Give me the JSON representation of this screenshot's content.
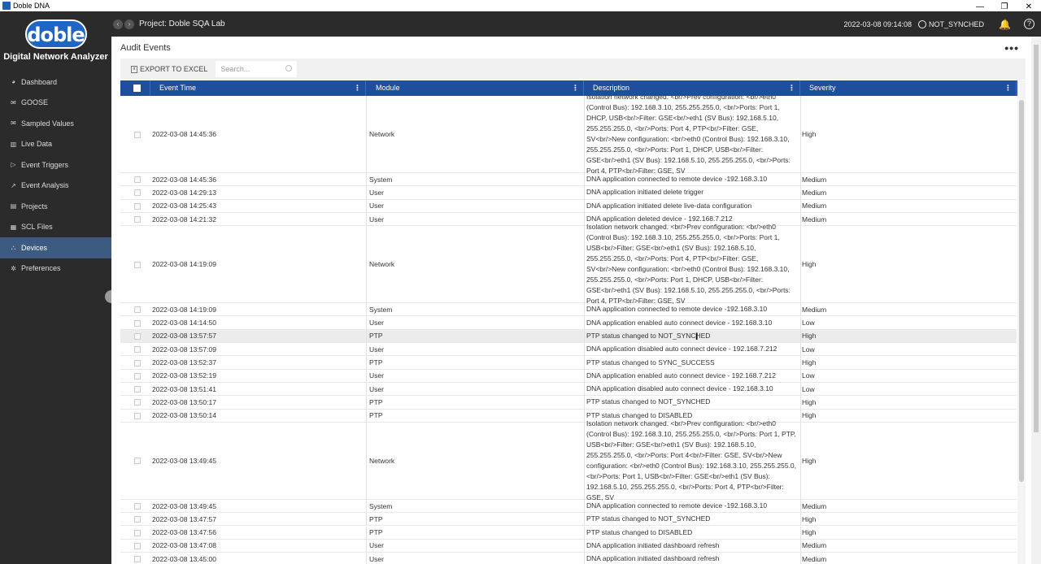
{
  "window": {
    "title": "Doble DNA",
    "controls": [
      "—",
      "❐",
      "✕"
    ]
  },
  "sidebar": {
    "logo_text": "doble",
    "app_title": "Digital Network Analyzer",
    "items": [
      {
        "label": "Dashboard",
        "icon": "dashboard-icon",
        "glyph": "◕"
      },
      {
        "label": "GOOSE",
        "icon": "envelope-icon",
        "glyph": "✉"
      },
      {
        "label": "Sampled Values",
        "icon": "envelope-icon",
        "glyph": "✉"
      },
      {
        "label": "Live Data",
        "icon": "chart-icon",
        "glyph": "▥"
      },
      {
        "label": "Event Triggers",
        "icon": "trigger-icon",
        "glyph": "▷"
      },
      {
        "label": "Event Analysis",
        "icon": "line-chart-icon",
        "glyph": "↗"
      },
      {
        "label": "Projects",
        "icon": "book-icon",
        "glyph": "▤"
      },
      {
        "label": "SCL Files",
        "icon": "file-icon",
        "glyph": "▦"
      },
      {
        "label": "Devices",
        "icon": "devices-icon",
        "glyph": "⛬",
        "active": true
      },
      {
        "label": "Preferences",
        "icon": "gear-icon",
        "glyph": "✲"
      }
    ]
  },
  "header": {
    "back": "‹",
    "forward": "›",
    "project": "Project: Doble SQA Lab",
    "datetime": "2022-03-08 09:14:08",
    "sync_status": "NOT_SYNCHED",
    "bell": "🔔",
    "help": "?"
  },
  "main": {
    "title": "Audit Events",
    "more": "•••",
    "export_label": "EXPORT TO EXCEL",
    "search_placeholder": "Search...",
    "columns": [
      "Event Time",
      "Module",
      "Description",
      "Severity"
    ],
    "rows": [
      {
        "time": "2022-03-08 14:45:36",
        "module": "Network",
        "desc": "Isolation network changed. <br/>Prev configuration: <br/>eth0 (Control Bus): 192.168.3.10, 255.255.255.0, <br/>Ports: Port 1, DHCP, USB<br/>Filter: GSE<br/>eth1 (SV Bus): 192.168.5.10, 255.255.255.0, <br/>Ports: Port 4, PTP<br/>Filter: GSE, SV<br/>New configuration: <br/>eth0 (Control Bus): 192.168.3.10, 255.255.255.0, <br/>Ports: Port 1, DHCP, USB<br/>Filter: GSE<br/>eth1 (SV Bus): 192.168.5.10, 255.255.255.0, <br/>Ports: Port 4, PTP<br/>Filter: GSE, SV",
        "severity": "High",
        "lines": 7
      },
      {
        "time": "2022-03-08 14:45:36",
        "module": "System",
        "desc": "DNA application connected to remote device -192.168.3.10",
        "severity": "Medium",
        "lines": 1
      },
      {
        "time": "2022-03-08 14:29:13",
        "module": "User",
        "desc": "DNA application initiated delete trigger",
        "severity": "Medium",
        "lines": 1
      },
      {
        "time": "2022-03-08 14:25:43",
        "module": "User",
        "desc": "DNA application initiated delete live-data configuration",
        "severity": "Medium",
        "lines": 1
      },
      {
        "time": "2022-03-08 14:21:32",
        "module": "User",
        "desc": "DNA application deleted device - 192.168.7.212",
        "severity": "Medium",
        "lines": 1
      },
      {
        "time": "2022-03-08 14:19:09",
        "module": "Network",
        "desc": "Isolation network changed. <br/>Prev configuration: <br/>eth0 (Control Bus): 192.168.3.10, 255.255.255.0, <br/>Ports: Port 1, USB<br/>Filter: GSE<br/>eth1 (SV Bus): 192.168.5.10, 255.255.255.0, <br/>Ports: Port 4, PTP<br/>Filter: GSE, SV<br/>New configuration: <br/>eth0 (Control Bus): 192.168.3.10, 255.255.255.0, <br/>Ports: Port 1, DHCP, USB<br/>Filter: GSE<br/>eth1 (SV Bus): 192.168.5.10, 255.255.255.0, <br/>Ports: Port 4, PTP<br/>Filter: GSE, SV",
        "severity": "High",
        "lines": 7
      },
      {
        "time": "2022-03-08 14:19:09",
        "module": "System",
        "desc": "DNA application connected to remote device -192.168.3.10",
        "severity": "Medium",
        "lines": 1
      },
      {
        "time": "2022-03-08 14:14:50",
        "module": "User",
        "desc": "DNA application enabled auto connect device - 192.168.3.10",
        "severity": "Low",
        "lines": 1
      },
      {
        "time": "2022-03-08 13:57:57",
        "module": "PTP",
        "desc": "PTP status changed to NOT_SYNCHED",
        "severity": "High",
        "lines": 1,
        "highlight": true
      },
      {
        "time": "2022-03-08 13:57:09",
        "module": "User",
        "desc": "DNA application disabled auto connect device - 192.168.7.212",
        "severity": "Low",
        "lines": 1
      },
      {
        "time": "2022-03-08 13:52:37",
        "module": "PTP",
        "desc": "PTP status changed to SYNC_SUCCESS",
        "severity": "High",
        "lines": 1
      },
      {
        "time": "2022-03-08 13:52:19",
        "module": "User",
        "desc": "DNA application enabled auto connect device - 192.168.7.212",
        "severity": "Low",
        "lines": 1
      },
      {
        "time": "2022-03-08 13:51:41",
        "module": "User",
        "desc": "DNA application disabled auto connect device - 192.168.3.10",
        "severity": "Low",
        "lines": 1
      },
      {
        "time": "2022-03-08 13:50:17",
        "module": "PTP",
        "desc": "PTP status changed to NOT_SYNCHED",
        "severity": "High",
        "lines": 1
      },
      {
        "time": "2022-03-08 13:50:14",
        "module": "PTP",
        "desc": "PTP status changed to DISABLED",
        "severity": "High",
        "lines": 1
      },
      {
        "time": "2022-03-08 13:49:45",
        "module": "Network",
        "desc": "Isolation network changed. <br/>Prev configuration: <br/>eth0 (Control Bus): 192.168.3.10, 255.255.255.0, <br/>Ports: Port 1, PTP, USB<br/>Filter: GSE<br/>eth1 (SV Bus): 192.168.5.10, 255.255.255.0, <br/>Ports: Port 4<br/>Filter: GSE, SV<br/>New configuration: <br/>eth0 (Control Bus): 192.168.3.10, 255.255.255.0, <br/>Ports: Port 1, USB<br/>Filter: GSE<br/>eth1 (SV Bus): 192.168.5.10, 255.255.255.0, <br/>Ports: Port 4, PTP<br/>Filter: GSE, SV",
        "severity": "High",
        "lines": 7
      },
      {
        "time": "2022-03-08 13:49:45",
        "module": "System",
        "desc": "DNA application connected to remote device -192.168.3.10",
        "severity": "Medium",
        "lines": 1
      },
      {
        "time": "2022-03-08 13:47:57",
        "module": "PTP",
        "desc": "PTP status changed to NOT_SYNCHED",
        "severity": "High",
        "lines": 1
      },
      {
        "time": "2022-03-08 13:47:56",
        "module": "PTP",
        "desc": "PTP status changed to DISABLED",
        "severity": "High",
        "lines": 1
      },
      {
        "time": "2022-03-08 13:47:08",
        "module": "User",
        "desc": "DNA application initiated dashboard refresh",
        "severity": "Medium",
        "lines": 1
      },
      {
        "time": "2022-03-08 13:45:00",
        "module": "User",
        "desc": "DNA application initiated dashboard refresh",
        "severity": "Medium",
        "lines": 1
      }
    ]
  }
}
